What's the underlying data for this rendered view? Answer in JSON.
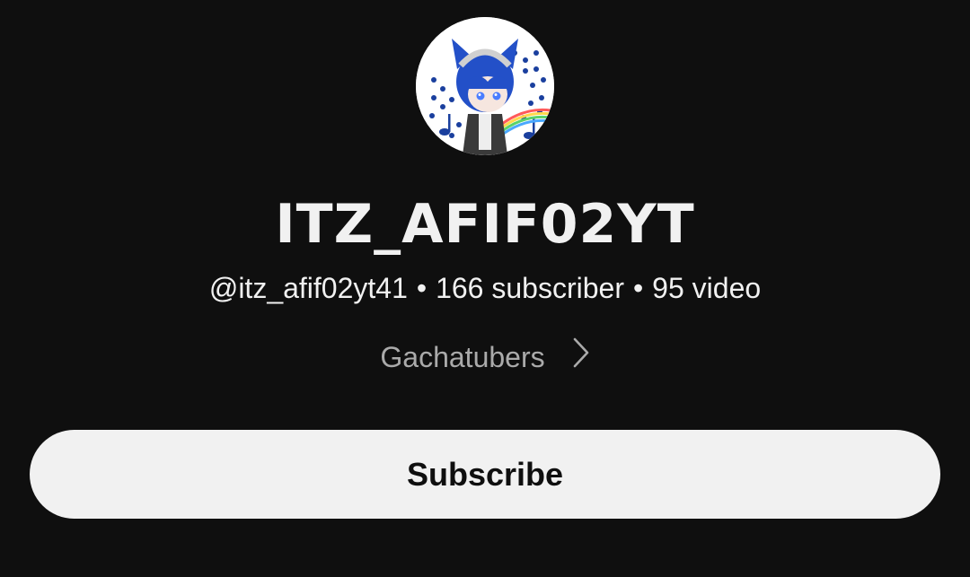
{
  "channel": {
    "name": "ITZ_AFIF02YT",
    "handle": "@itz_afif02yt41",
    "separator": "•",
    "subscribers": "166 subscriber",
    "videos": "95 video",
    "category": "Gachatubers"
  },
  "actions": {
    "subscribe_label": "Subscribe"
  },
  "icons": {
    "category_chevron": "chevron-right-icon"
  },
  "colors": {
    "background": "#0f0f0f",
    "primary_text": "#f1f1f1",
    "secondary_text": "#aaaaaa",
    "button_bg": "#f1f1f1",
    "button_text": "#0f0f0f"
  }
}
